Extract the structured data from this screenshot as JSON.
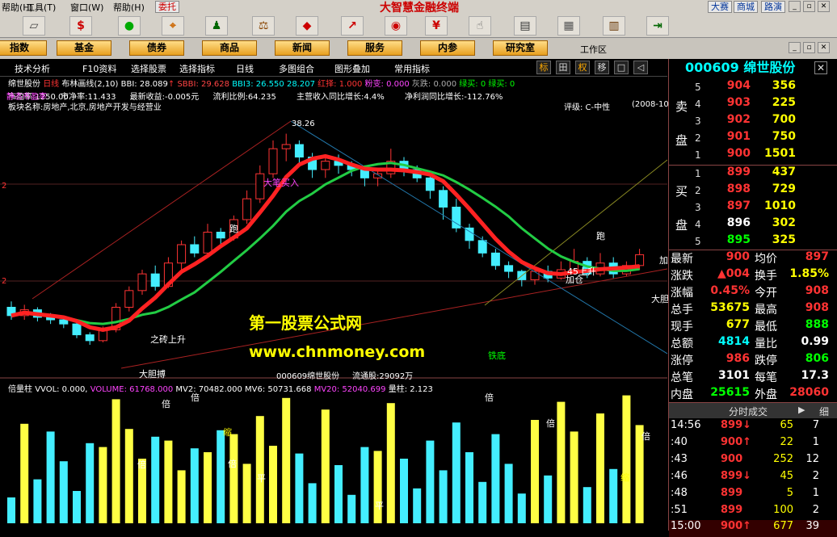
{
  "menu": {
    "items": [
      "帮助(H)",
      "工具(T)",
      "窗口(W)",
      "帮助(H)"
    ],
    "window_item": "窗口(W)",
    "tool_item": "工具(T)",
    "help_item": "帮助(H)",
    "trade_item": "委托",
    "app_title": "大智慧金融终端",
    "dasai": "大赛",
    "shangcheng": "商城",
    "lutong": "路演"
  },
  "toolbar": {
    "icons": [
      "ruler-icon",
      "dollar-icon",
      "traffic-icon",
      "binocular-icon",
      "chart-icon",
      "scale-icon",
      "palette-icon",
      "arrow-icon",
      "phone-icon",
      "money-icon",
      "hand-icon",
      "news-icon",
      "grid-icon",
      "book-icon",
      "exit-icon"
    ]
  },
  "modes": [
    "指数",
    "基金",
    "债券",
    "商品",
    "新闻",
    "服务",
    "内参",
    "研究室"
  ],
  "workarea": "工作区",
  "subbar": {
    "items": [
      "技术分析",
      "F10资料",
      "选择股票",
      "选择指标",
      "日线",
      "多图组合",
      "图形叠加",
      "常用指标"
    ],
    "sbtns": [
      "标",
      "田",
      "权",
      "移",
      "□",
      "◁"
    ]
  },
  "indicator": {
    "name": "绵世股份",
    "period": "日线",
    "boll": "布林画线(2,10)",
    "bbi": "BBI: 28.089",
    "sbbi": "SBBI: 29.628",
    "bbi3": "BBI3: 26.550",
    "v2": "28.207",
    "hongze": "红择: 1.000",
    "fenbian": "粉变: 0.000",
    "huidie": "灰跌: 0.000",
    "lvmai": "绿买: 0",
    "lvmai2": "绿买: 0"
  },
  "info1": {
    "pe": "市盈率:1250.00",
    "pe_label": "静态市盈率",
    "pb": "市净率:11.433",
    "eps": "最新收益:-0.005元",
    "float": "流利比例:64.235",
    "rev": "主营收入同比增长:4.4%",
    "profit": "净利润同比增长:-112.76%"
  },
  "info2": {
    "sector": "板块名称:房地产,北京,房地产开发与经营业",
    "rating": "评级: C-中性",
    "date": "(2008-10"
  },
  "chart_labels": {
    "high": "38.26",
    "dabi": "大笔买入",
    "pao1": "跑",
    "pao2": "跑",
    "zhichuan": "之砖上升",
    "dadan": "大胆搏",
    "shang45": "45上升",
    "jiacang": "加仓",
    "tiedi": "铁底",
    "daban": "大胆",
    "jia": "加",
    "tongji": "通买",
    "stockline": "000609绵世股份",
    "float_text": "流通股:29092万"
  },
  "watermark": {
    "line1": "第一股票公式网",
    "line2": "www.chnmoney.com"
  },
  "volume": {
    "name": "倍量柱",
    "vvol": "VVOL: 0.000,",
    "volume": "VOLUME: 61768.000",
    "mv2": "MV2: 70482.000",
    "mv6": "MV6: 50731.668",
    "mv20": "MV20: 52040.699",
    "liang": "量柱: 2.123"
  },
  "vol_labels": [
    "倍",
    "倍",
    "倍",
    "缩",
    "倍",
    "倍",
    "平",
    "平",
    "倍",
    "缩",
    "倍"
  ],
  "stock": {
    "code_name": "000609 绵世股份"
  },
  "book": {
    "sell_label": [
      "卖",
      "盘"
    ],
    "buy_label": [
      "买",
      "盘"
    ],
    "sells": [
      {
        "lvl": "5",
        "price": "904",
        "vol": "356"
      },
      {
        "lvl": "4",
        "price": "903",
        "vol": "225"
      },
      {
        "lvl": "3",
        "price": "902",
        "vol": "700"
      },
      {
        "lvl": "2",
        "price": "901",
        "vol": "750"
      },
      {
        "lvl": "1",
        "price": "900",
        "vol": "1501"
      }
    ],
    "buys": [
      {
        "lvl": "1",
        "price": "899",
        "vol": "437"
      },
      {
        "lvl": "2",
        "price": "898",
        "vol": "729"
      },
      {
        "lvl": "3",
        "price": "897",
        "vol": "1010"
      },
      {
        "lvl": "4",
        "price": "896",
        "vol": "302"
      },
      {
        "lvl": "5",
        "price": "895",
        "vol": "325"
      }
    ]
  },
  "stats": [
    {
      "l": "最新",
      "v": "900",
      "l2": "均价",
      "v2": "897"
    },
    {
      "l": "涨跌",
      "v": "▲004",
      "l2": "换手",
      "v2": "1.85%"
    },
    {
      "l": "涨幅",
      "v": "0.45%",
      "l2": "今开",
      "v2": "908"
    },
    {
      "l": "总手",
      "v": "53675",
      "l2": "最高",
      "v2": "908"
    },
    {
      "l": "现手",
      "v": "677",
      "l2": "最低",
      "v2": "888"
    },
    {
      "l": "总额",
      "v": "4814",
      "l2": "量比",
      "v2": "0.99"
    },
    {
      "l": "涨停",
      "v": "986",
      "l2": "跌停",
      "v2": "806"
    },
    {
      "l": "总笔",
      "v": "3101",
      "l2": "每笔",
      "v2": "17.3"
    },
    {
      "l": "内盘",
      "v": "25615",
      "l2": "外盘",
      "v2": "28060"
    }
  ],
  "ticks_header": {
    "title": "分时成交",
    "detail": "细"
  },
  "ticks": [
    {
      "t": "14:56",
      "p": "899↓",
      "v": "65",
      "n": "7"
    },
    {
      "t": ":40",
      "p": "900↑",
      "v": "22",
      "n": "1"
    },
    {
      "t": ":43",
      "p": "900",
      "v": "252",
      "n": "12"
    },
    {
      "t": ":46",
      "p": "899↓",
      "v": "45",
      "n": "2"
    },
    {
      "t": ":48",
      "p": "899",
      "v": "5",
      "n": "1"
    },
    {
      "t": ":51",
      "p": "899",
      "v": "100",
      "n": "2"
    },
    {
      "t": "15:00",
      "p": "900↑",
      "v": "677",
      "n": "39"
    }
  ],
  "colors": {
    "up": "#ff3333",
    "down": "#00ffff",
    "bg": "#000000",
    "accent": "#ffff00"
  },
  "candles": [
    [
      1,
      17.5,
      16.5,
      18.2,
      16.0
    ],
    [
      2,
      16.5,
      17.2,
      17.8,
      16.0
    ],
    [
      3,
      17.2,
      16.3,
      17.5,
      15.8
    ],
    [
      4,
      16.3,
      16.0,
      16.8,
      15.5
    ],
    [
      5,
      16.0,
      15.5,
      16.5,
      15.0
    ],
    [
      6,
      15.5,
      14.2,
      15.8,
      13.8
    ],
    [
      7,
      14.2,
      13.5,
      14.5,
      13.0
    ],
    [
      8,
      13.5,
      14.8,
      15.2,
      13.3
    ],
    [
      9,
      14.8,
      17.5,
      18.0,
      14.5
    ],
    [
      10,
      17.5,
      19.5,
      20.0,
      17.0
    ],
    [
      11,
      19.5,
      21.5,
      22.0,
      19.0
    ],
    [
      12,
      21.5,
      20.0,
      22.5,
      19.5
    ],
    [
      13,
      20.0,
      22.8,
      23.5,
      19.8
    ],
    [
      14,
      22.8,
      25.0,
      25.5,
      22.0
    ],
    [
      15,
      25.0,
      24.0,
      26.0,
      23.5
    ],
    [
      16,
      24.0,
      26.5,
      27.5,
      23.5
    ],
    [
      17,
      26.5,
      25.8,
      27.0,
      25.0
    ],
    [
      18,
      25.8,
      28.0,
      28.5,
      25.5
    ],
    [
      19,
      28.0,
      30.5,
      31.5,
      27.5
    ],
    [
      20,
      30.5,
      33.5,
      34.5,
      30.0
    ],
    [
      21,
      33.5,
      36.5,
      37.5,
      33.0
    ],
    [
      22,
      36.5,
      37.0,
      38.3,
      35.0
    ],
    [
      23,
      37.0,
      35.5,
      37.5,
      34.5
    ],
    [
      24,
      35.5,
      34.0,
      36.0,
      33.0
    ],
    [
      25,
      34.0,
      35.0,
      35.5,
      33.0
    ],
    [
      26,
      35.0,
      34.5,
      35.8,
      33.5
    ],
    [
      27,
      34.5,
      34.0,
      35.0,
      33.2
    ],
    [
      28,
      34.0,
      33.0,
      34.5,
      32.0
    ],
    [
      29,
      33.0,
      33.5,
      34.0,
      32.0
    ],
    [
      30,
      33.5,
      35.0,
      36.5,
      33.0
    ],
    [
      31,
      35.0,
      34.0,
      35.5,
      33.2
    ],
    [
      32,
      34.0,
      33.0,
      34.5,
      32.5
    ],
    [
      33,
      33.0,
      31.5,
      33.5,
      30.5
    ],
    [
      34,
      31.5,
      29.5,
      32.0,
      28.0
    ],
    [
      35,
      29.5,
      27.0,
      30.5,
      26.5
    ],
    [
      36,
      27.0,
      25.5,
      27.5,
      24.5
    ],
    [
      37,
      25.5,
      24.0,
      26.0,
      23.5
    ],
    [
      38,
      24.0,
      22.5,
      24.5,
      22.0
    ],
    [
      39,
      22.5,
      21.8,
      23.0,
      21.0
    ],
    [
      40,
      21.8,
      20.8,
      22.0,
      20.0
    ],
    [
      41,
      20.8,
      21.8,
      22.0,
      20.2
    ],
    [
      42,
      21.8,
      21.0,
      22.5,
      20.5
    ],
    [
      43,
      21.0,
      22.0,
      23.0,
      20.8
    ],
    [
      44,
      22.0,
      23.0,
      24.5,
      21.8
    ],
    [
      45,
      23.0,
      21.5,
      23.5,
      21.0
    ],
    [
      46,
      21.5,
      22.8,
      24.0,
      21.2
    ],
    [
      47,
      22.8,
      21.5,
      23.5,
      21.0
    ],
    [
      48,
      21.5,
      22.5,
      23.0,
      21.2
    ],
    [
      49,
      22.5,
      23.8,
      24.5,
      22.0
    ]
  ]
}
